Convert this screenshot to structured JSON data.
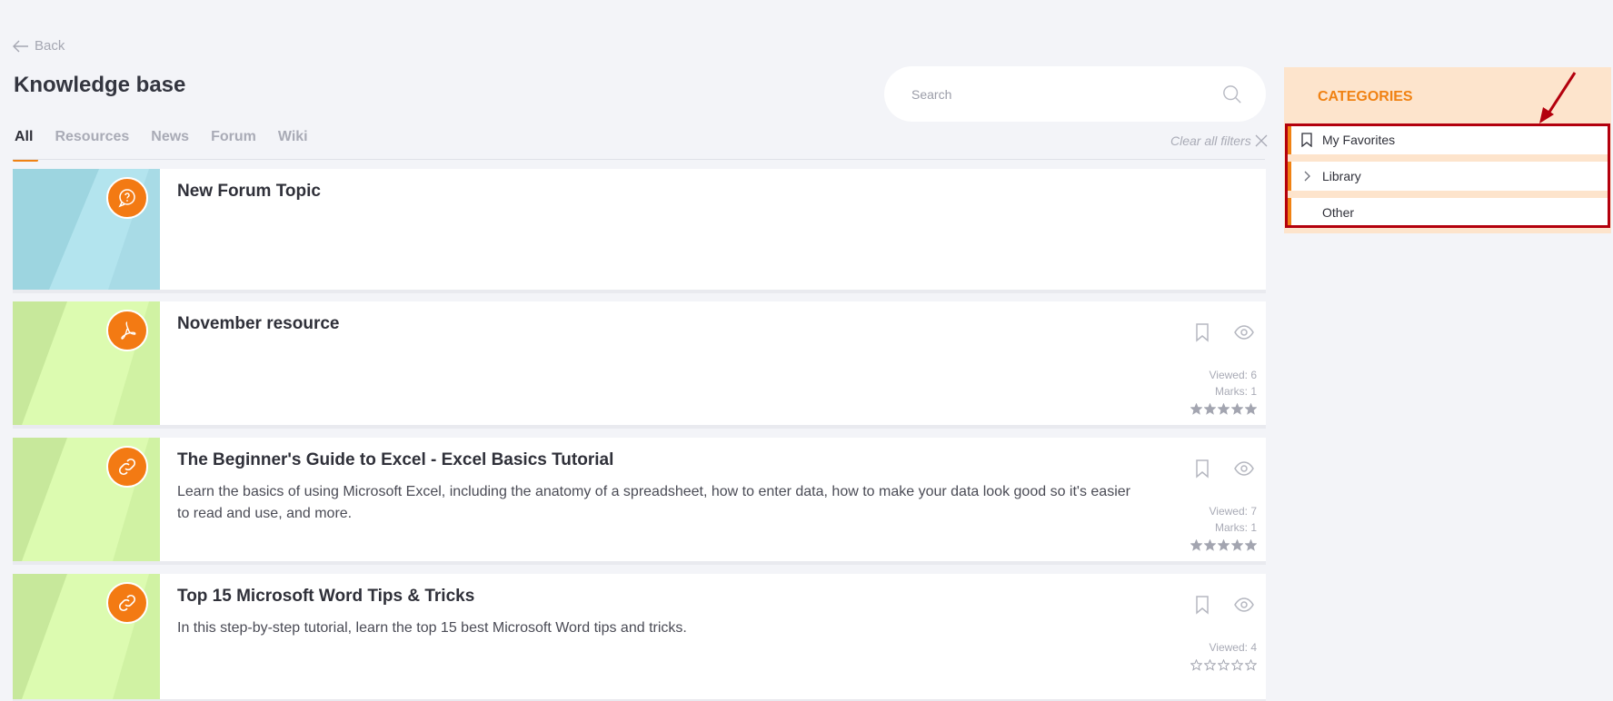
{
  "nav": {
    "back_label": "Back"
  },
  "page": {
    "title": "Knowledge base"
  },
  "tabs": [
    {
      "label": "All",
      "active": true
    },
    {
      "label": "Resources",
      "active": false
    },
    {
      "label": "News",
      "active": false
    },
    {
      "label": "Forum",
      "active": false
    },
    {
      "label": "Wiki",
      "active": false
    }
  ],
  "search": {
    "placeholder": "Search",
    "value": ""
  },
  "filters": {
    "clear_label": "Clear all filters"
  },
  "items": [
    {
      "title": "New Forum Topic",
      "description": "",
      "icon": "forum-question-icon",
      "theme": "blue"
    },
    {
      "title": "November resource",
      "description": "",
      "icon": "pdf-icon",
      "theme": "green",
      "viewed": "Viewed: 6",
      "marks": "Marks: 1",
      "rating": 5
    },
    {
      "title": "The Beginner's Guide to Excel - Excel Basics Tutorial",
      "description": "Learn the basics of using Microsoft Excel, including the anatomy of a spreadsheet, how to enter data, how to make your data look good so it's easier to read and use, and more.",
      "icon": "link-icon",
      "theme": "green",
      "viewed": "Viewed: 7",
      "marks": "Marks: 1",
      "rating": 5
    },
    {
      "title": "Top 15 Microsoft Word Tips & Tricks",
      "description": "In this step-by-step tutorial, learn the top 15 best Microsoft Word tips and tricks.",
      "icon": "link-icon",
      "theme": "green",
      "viewed": "Viewed: 4",
      "rating": 0
    }
  ],
  "categories": {
    "title": "CATEGORIES",
    "items": [
      {
        "label": "My Favorites",
        "icon": "bookmark-icon"
      },
      {
        "label": "Library",
        "icon": "chevron-right-icon"
      },
      {
        "label": "Other",
        "icon": ""
      }
    ]
  },
  "colors": {
    "accent": "#f08213",
    "highlight": "#b3000d",
    "background": "#f3f4f8"
  }
}
